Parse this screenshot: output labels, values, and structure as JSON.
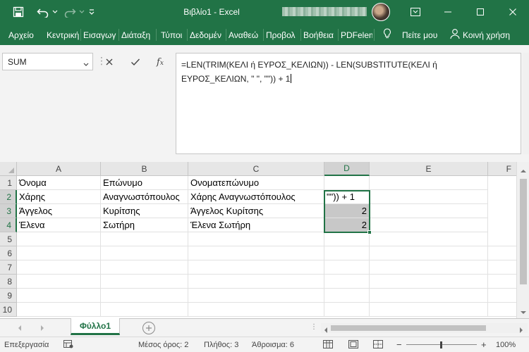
{
  "window": {
    "title": "Βιβλίο1  -  Excel",
    "accent": "#217346"
  },
  "icons": {
    "save": "save-icon",
    "undo": "undo-icon",
    "redo": "redo-icon",
    "qat": "customize-quick-access-icon",
    "ribbon_display": "ribbon-display-options-icon",
    "minimize": "minimize-icon",
    "maximize": "maximize-icon",
    "close": "close-icon",
    "tell_me": "lightbulb-icon",
    "share": "person-icon"
  },
  "ribbon": {
    "tabs": [
      "Αρχείο",
      "Κεντρική",
      "Εισαγωγ",
      "Διάταξη",
      "Τύποι",
      "Δεδομέν",
      "Αναθεώ",
      "Προβολ",
      "Βοήθεια",
      "PDFelem"
    ],
    "tell_me": "Πείτε μου",
    "share": "Κοινή χρήση"
  },
  "formula_bar": {
    "name_box": "SUM",
    "formula": "=LEN(TRIM(ΚΕΛΙ ή ΕΥΡΟΣ_ΚΕΛΙΩΝ)) - LEN(SUBSTITUTE(ΚΕΛΙ ή\nΕΥΡΟΣ_ΚΕΛΙΩΝ, \" \", \"\")) + 1"
  },
  "sheet": {
    "columns": [
      "A",
      "B",
      "C",
      "D",
      "E",
      "F"
    ],
    "rows": [
      "1",
      "2",
      "3",
      "4",
      "5",
      "6",
      "7",
      "8",
      "9",
      "10"
    ],
    "cells": [
      [
        "Όνομα",
        "Επώνυμο",
        "Ονοματεπώνυμο",
        "",
        ""
      ],
      [
        "Χάρης",
        "Αναγνωστόπουλος",
        "Χάρης Αναγνωστόπουλος",
        "\"\")) + 1",
        ""
      ],
      [
        "Άγγελος",
        "Κυρίτσης",
        "Άγγελος Κυρίτσης",
        "2",
        ""
      ],
      [
        "Έλενα",
        "Σωτήρη",
        "Έλενα Σωτήρη",
        "2",
        ""
      ]
    ]
  },
  "tabs": {
    "active_sheet": "Φύλλο1",
    "dots": "⋮"
  },
  "status": {
    "mode": "Επεξεργασία",
    "average": "Μέσος όρος: 2",
    "count": "Πλήθος: 3",
    "sum": "Άθροισμα: 6",
    "zoom": "100%"
  }
}
